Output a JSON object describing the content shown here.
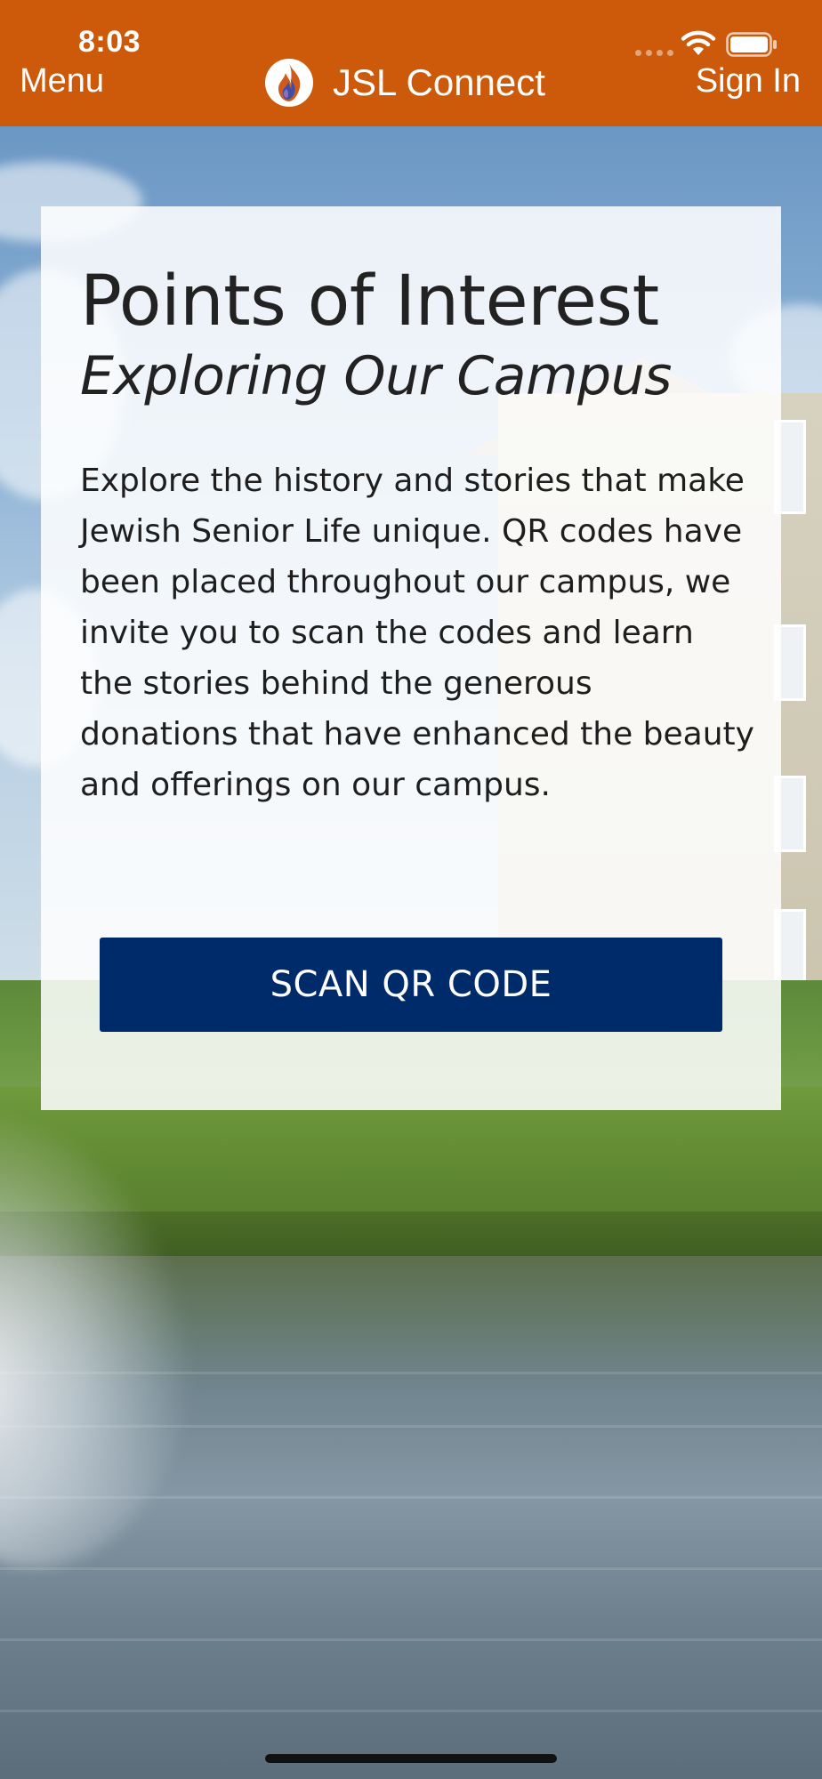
{
  "status_bar": {
    "time": "8:03",
    "icons": [
      "signal-dots-icon",
      "wifi-icon",
      "battery-icon"
    ]
  },
  "header": {
    "menu_label": "Menu",
    "app_title": "JSL Connect",
    "sign_in_label": "Sign In",
    "logo_icon": "jsl-flame-logo-icon",
    "background_color": "#cc5a0a"
  },
  "card": {
    "title": "Points of Interest",
    "subtitle": "Exploring Our Campus",
    "body": "Explore the history and stories that make Jewish Senior Life unique. QR codes have been placed throughout our campus, we invite you to scan the codes and learn the stories behind the generous donations that have enhanced the beauty and offerings on our campus.",
    "scan_button_label": "SCAN QR CODE",
    "button_color": "#002b6a"
  }
}
